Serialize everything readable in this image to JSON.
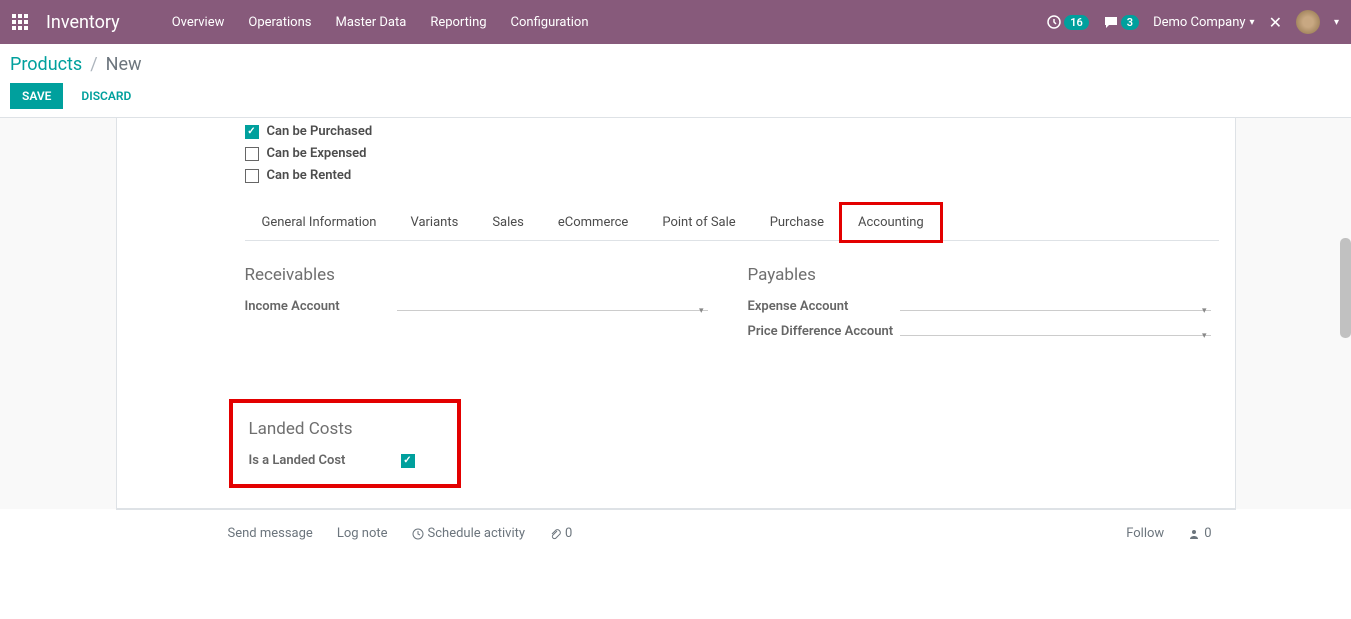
{
  "nav": {
    "app_title": "Inventory",
    "items": [
      "Overview",
      "Operations",
      "Master Data",
      "Reporting",
      "Configuration"
    ],
    "timer_badge": "16",
    "chat_badge": "3",
    "company": "Demo Company"
  },
  "breadcrumb": {
    "link": "Products",
    "current": "New"
  },
  "buttons": {
    "save": "SAVE",
    "discard": "DISCARD"
  },
  "checkboxes": {
    "can_be_purchased": "Can be Purchased",
    "can_be_expensed": "Can be Expensed",
    "can_be_rented": "Can be Rented"
  },
  "tabs": [
    "General Information",
    "Variants",
    "Sales",
    "eCommerce",
    "Point of Sale",
    "Purchase",
    "Accounting"
  ],
  "accounting": {
    "receivables_title": "Receivables",
    "income_account_label": "Income Account",
    "payables_title": "Payables",
    "expense_account_label": "Expense Account",
    "price_diff_label": "Price Difference Account",
    "landed_costs_title": "Landed Costs",
    "is_landed_cost_label": "Is a Landed Cost"
  },
  "chatter": {
    "send_message": "Send message",
    "log_note": "Log note",
    "schedule_activity": "Schedule activity",
    "attachments": "0",
    "follow": "Follow",
    "followers": "0"
  }
}
